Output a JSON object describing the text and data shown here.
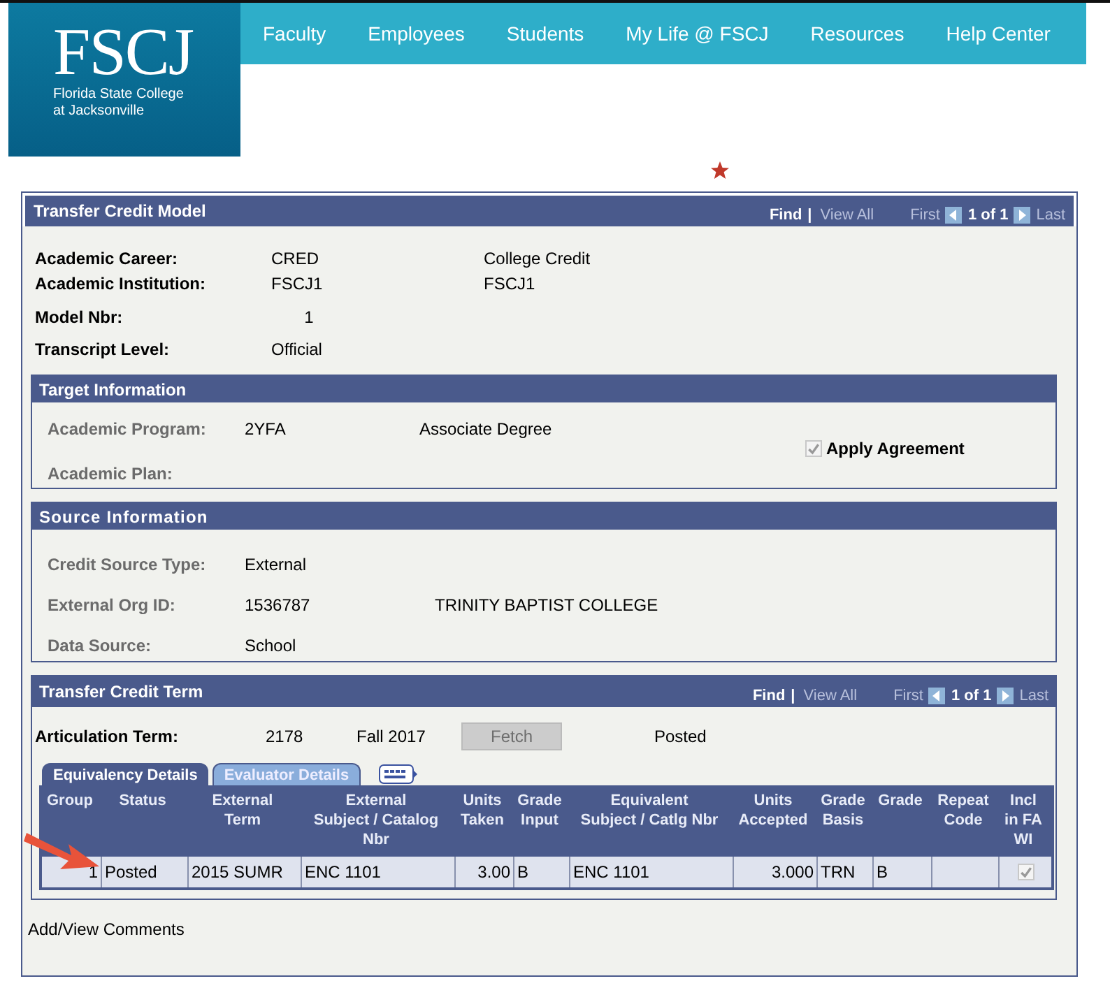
{
  "logo": {
    "name": "FSCJ",
    "subtitle": [
      "Florida State College",
      "at Jacksonville"
    ]
  },
  "nav": [
    "Faculty",
    "Employees",
    "Students",
    "My Life @ FSCJ",
    "Resources",
    "Help Center"
  ],
  "model": {
    "title": "Transfer Credit Model",
    "pager": {
      "find": "Find",
      "separator": "|",
      "view_all": "View All",
      "first": "First",
      "count": "1 of 1",
      "last": "Last"
    },
    "fields": [
      {
        "label": "Academic Career:",
        "value": "CRED",
        "description": "College Credit"
      },
      {
        "label": "Academic Institution:",
        "value": "FSCJ1",
        "description": "FSCJ1"
      },
      {
        "label": "Model Nbr:",
        "value": "1"
      },
      {
        "label": "Transcript Level:",
        "value": "Official"
      }
    ]
  },
  "target": {
    "title": "Target Information",
    "fields": [
      {
        "label": "Academic Program:",
        "value": "2YFA",
        "description": "Associate Degree"
      },
      {
        "label": "Academic Plan:"
      }
    ],
    "apply_agreement": {
      "label": "Apply Agreement",
      "checked": true,
      "disabled": true
    }
  },
  "source": {
    "title": "Source Information",
    "fields": [
      {
        "label": "Credit Source Type:",
        "value": "External"
      },
      {
        "label": "External Org ID:",
        "value": "1536787",
        "description": "TRINITY BAPTIST COLLEGE"
      },
      {
        "label": "Data Source:",
        "value": "School"
      }
    ]
  },
  "term": {
    "title": "Transfer Credit Term",
    "pager": {
      "find": "Find",
      "separator": "|",
      "view_all": "View All",
      "first": "First",
      "count": "1 of 1",
      "last": "Last"
    },
    "articulation": {
      "label": "Articulation Term:",
      "code": "2178",
      "term": "Fall 2017",
      "button": {
        "label": "Fetch",
        "disabled": true
      },
      "status": "Posted"
    },
    "tabs": [
      {
        "label": "Equivalency Details",
        "selected": true
      },
      {
        "label": "Evaluator Details",
        "selected": false
      }
    ],
    "columns": [
      "Group",
      "Status",
      "External\nTerm",
      "External\nSubject / Catalog\nNbr",
      "Units\nTaken",
      "Grade\nInput",
      "Equivalent\nSubject / Catlg Nbr",
      "Units\nAccepted",
      "Grade\nBasis",
      "Grade",
      "Repeat\nCode",
      "Incl\nin FA\nWI"
    ],
    "rows": [
      {
        "cells": [
          "1",
          "Posted",
          "2015 SUMR",
          "ENC 1101",
          "3.00",
          "B",
          "ENC 1101",
          "3.000",
          "TRN",
          "B",
          ""
        ],
        "incl_fa_wi": {
          "checked": true,
          "disabled": true
        }
      }
    ]
  },
  "footer_link": "Add/View Comments"
}
